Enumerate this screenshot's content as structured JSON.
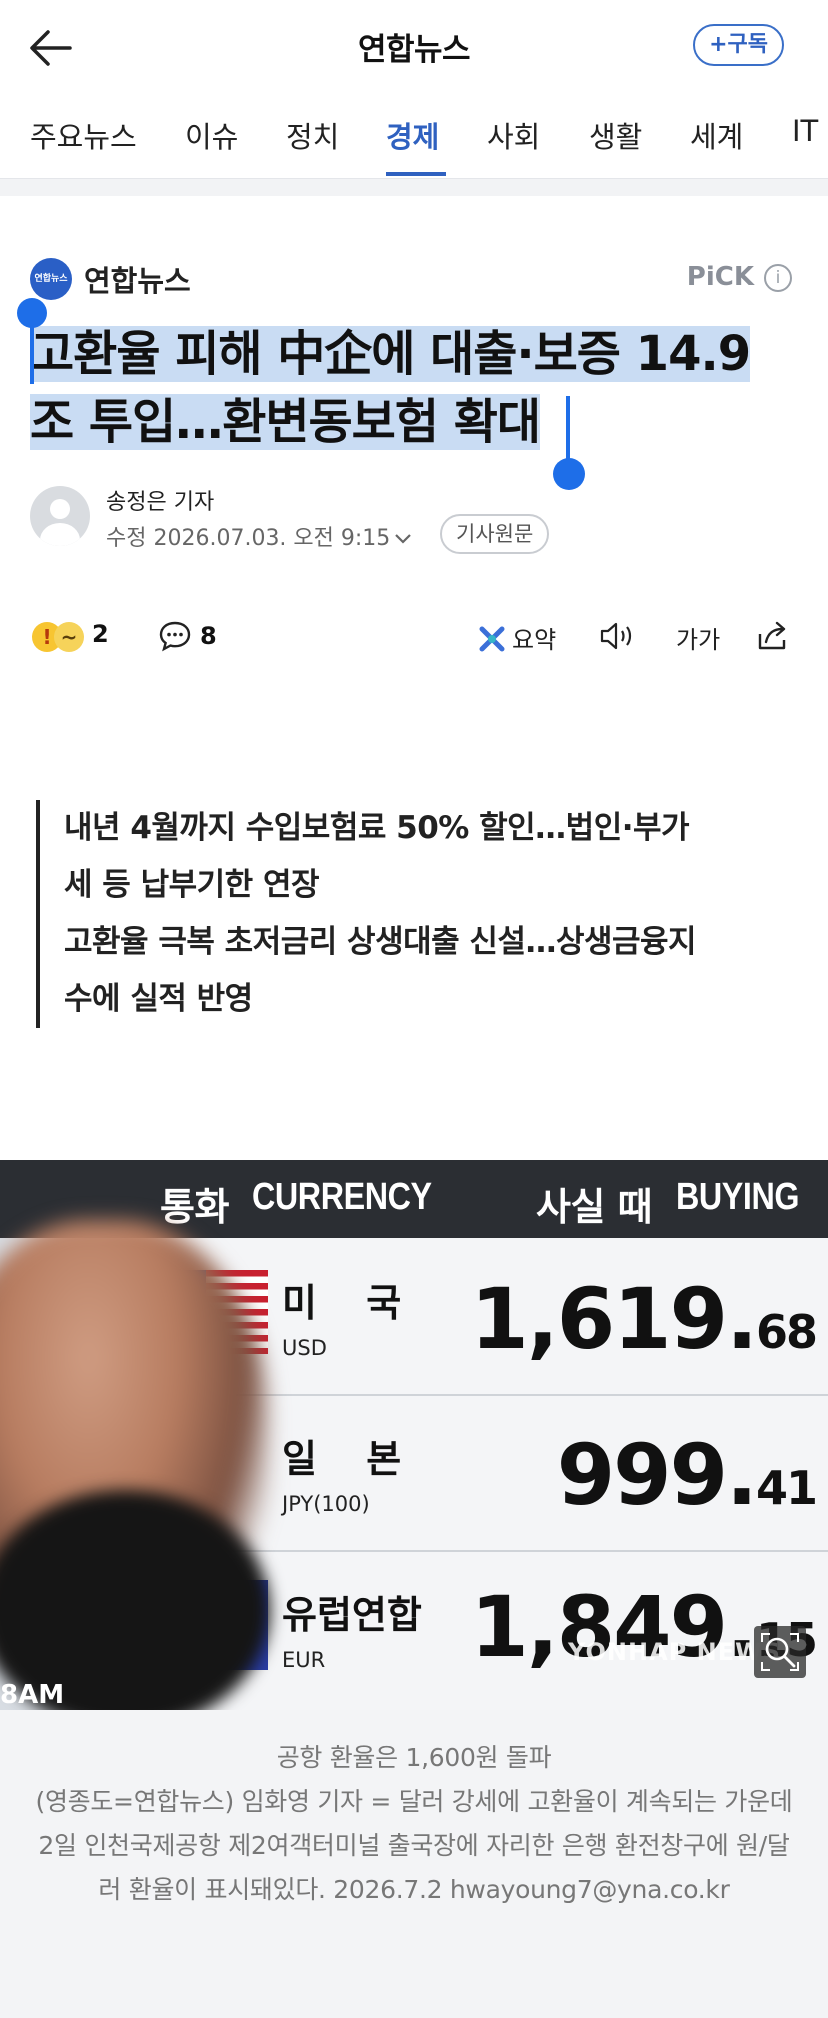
{
  "header": {
    "title": "연합뉴스",
    "subscribe_label": "+구독"
  },
  "tabs": [
    {
      "label": "주요뉴스"
    },
    {
      "label": "이슈"
    },
    {
      "label": "정치"
    },
    {
      "label": "경제",
      "active": true
    },
    {
      "label": "사회"
    },
    {
      "label": "생활"
    },
    {
      "label": "세계"
    },
    {
      "label": "IT"
    }
  ],
  "press": {
    "name": "연합뉴스",
    "logo_text": "연합뉴스",
    "pick_label": "PiCK",
    "info_glyph": "i"
  },
  "article": {
    "headline_line1": "고환율 피해 中企에 대출·보증 14.9",
    "headline_line2": "조 투입…환변동보험 확대",
    "author": "송정은 기자",
    "modified": "수정 2026.07.03. 오전 9:15",
    "original_button": "기사원문"
  },
  "actions": {
    "reaction_count": "2",
    "comment_count": "8",
    "summary_label": "요약",
    "font_label": "가가"
  },
  "summary": [
    "내년 4월까지 수입보험료 50% 할인…법인·부가",
    "세 등 납부기한 연장",
    "고환율 극복 초저금리 상생대출 신설…상생금융지",
    "수에 실적 반영"
  ],
  "photo": {
    "header_left_ko": "통화",
    "header_left_en": "CURRENCY",
    "header_right_ko": "사실 때",
    "header_right_en": "BUYING",
    "rows": [
      {
        "name": "미 국",
        "code": "USD",
        "rate_main": "1,619.",
        "rate_dec": "68"
      },
      {
        "name": "일 본",
        "code": "JPY(100)",
        "rate_main": "999.",
        "rate_dec": "41"
      },
      {
        "name": "유럽연합",
        "code": "EUR",
        "rate_main": "1,849.",
        "rate_dec": "15"
      }
    ],
    "time_fragment": "8AM",
    "watermark": "YONHAP NEWS"
  },
  "caption": {
    "line1": "공항 환율은 1,600원 돌파",
    "body": "(영종도=연합뉴스) 임화영 기자 = 달러 강세에 고환율이 계속되는 가운데 2일 인천국제공항 제2여객터미널 출국장에 자리한 은행 환전창구에 원/달러 환율이 표시돼있다. 2026.7.2 hwayoung7@yna.co.kr"
  },
  "colors": {
    "accent": "#2f61c0",
    "selection": "#c9dcf3",
    "selection_handle": "#1e6ee8"
  }
}
